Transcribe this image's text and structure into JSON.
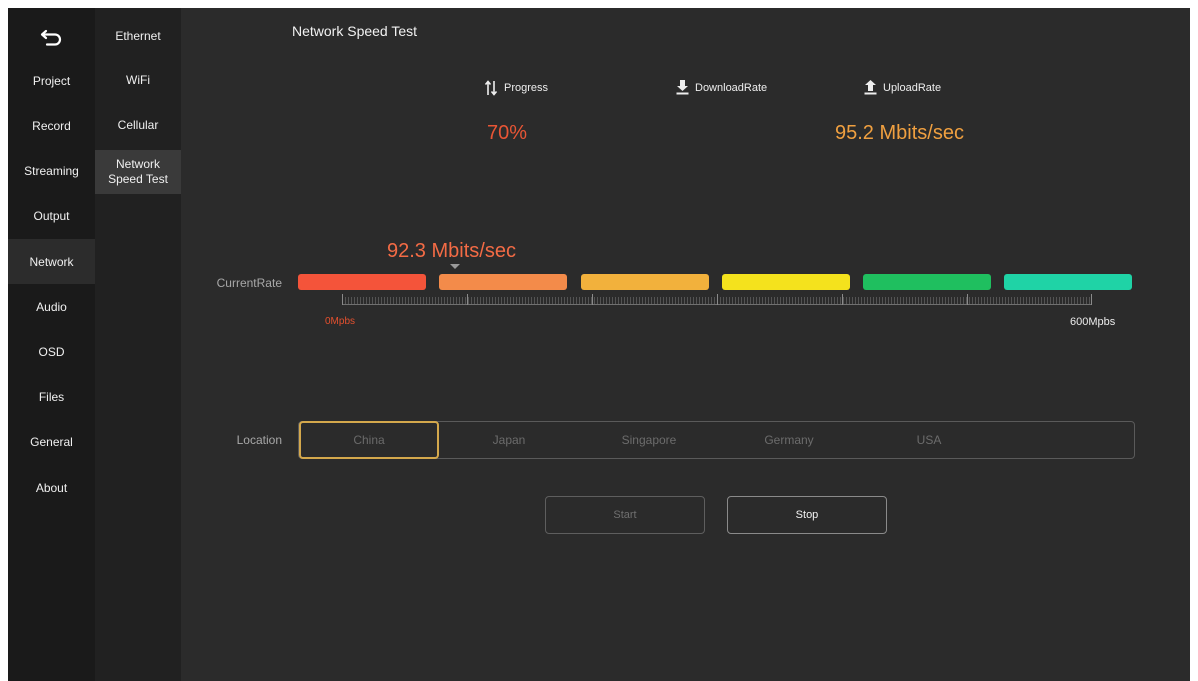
{
  "nav": {
    "back_icon": "back-arrow-icon",
    "items": [
      {
        "label": "Project"
      },
      {
        "label": "Record"
      },
      {
        "label": "Streaming"
      },
      {
        "label": "Output"
      },
      {
        "label": "Network",
        "active": true
      },
      {
        "label": "Audio"
      },
      {
        "label": "OSD"
      },
      {
        "label": "Files"
      },
      {
        "label": "General"
      },
      {
        "label": "About"
      }
    ]
  },
  "subnav": {
    "items": [
      {
        "label": "Ethernet"
      },
      {
        "label": "WiFi"
      },
      {
        "label": "Cellular"
      },
      {
        "label": "Network Speed Test",
        "active": true
      }
    ]
  },
  "page": {
    "title": "Network Speed Test",
    "stats": {
      "progress_label": "Progress",
      "download_label": "DownloadRate",
      "upload_label": "UploadRate",
      "progress_value": "70%",
      "upload_value": "95.2 Mbits/sec"
    },
    "current_rate": {
      "label": "CurrentRate",
      "value": "92.3 Mbits/sec",
      "scale_min": "0Mpbs",
      "scale_max": "600Mpbs",
      "segment_colors": [
        "#f4543a",
        "#f38b4a",
        "#f2b13c",
        "#f4e21d",
        "#1fbf5f",
        "#1fd3a6"
      ]
    },
    "location": {
      "label": "Location",
      "options": [
        "China",
        "Japan",
        "Singapore",
        "Germany",
        "USA"
      ],
      "selected": "China"
    },
    "buttons": {
      "start_label": "Start",
      "stop_label": "Stop"
    }
  },
  "colors": {
    "progress_value": "#e85535",
    "upload_value": "#f0a040",
    "accent_selected": "#d4a84c"
  }
}
